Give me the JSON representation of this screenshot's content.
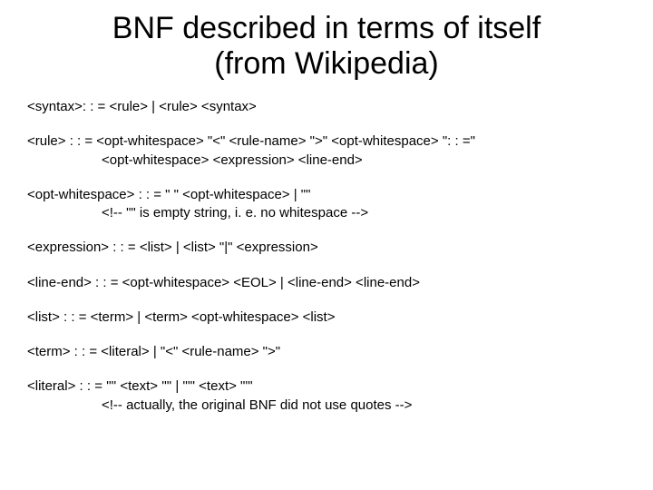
{
  "title_line1": "BNF described in terms of itself",
  "title_line2": "(from Wikipedia)",
  "rules": {
    "r1": "<syntax>: : = <rule> | <rule> <syntax>",
    "r2a": "<rule>    : : = <opt-whitespace> \"<\" <rule-name> \">\" <opt-whitespace> \": : =\"",
    "r2b": "<opt-whitespace> <expression> <line-end>",
    "r3a": "<opt-whitespace> : : = \" \" <opt-whitespace> | \"\"",
    "r3b": "<!-- \"\" is empty string, i. e. no whitespace -->",
    "r4": "<expression> : : = <list> | <list> \"|\" <expression>",
    "r5": "<line-end> : : = <opt-whitespace> <EOL> | <line-end> <line-end>",
    "r6": "<list> : : = <term> | <term> <opt-whitespace> <list>",
    "r7": "<term> : : = <literal> | \"<\" <rule-name> \">\"",
    "r8a": "<literal> : : = '\"' <text> '\"' | \"'\" <text> \"'\"",
    "r8b": "<!-- actually, the original BNF did not use quotes -->"
  }
}
